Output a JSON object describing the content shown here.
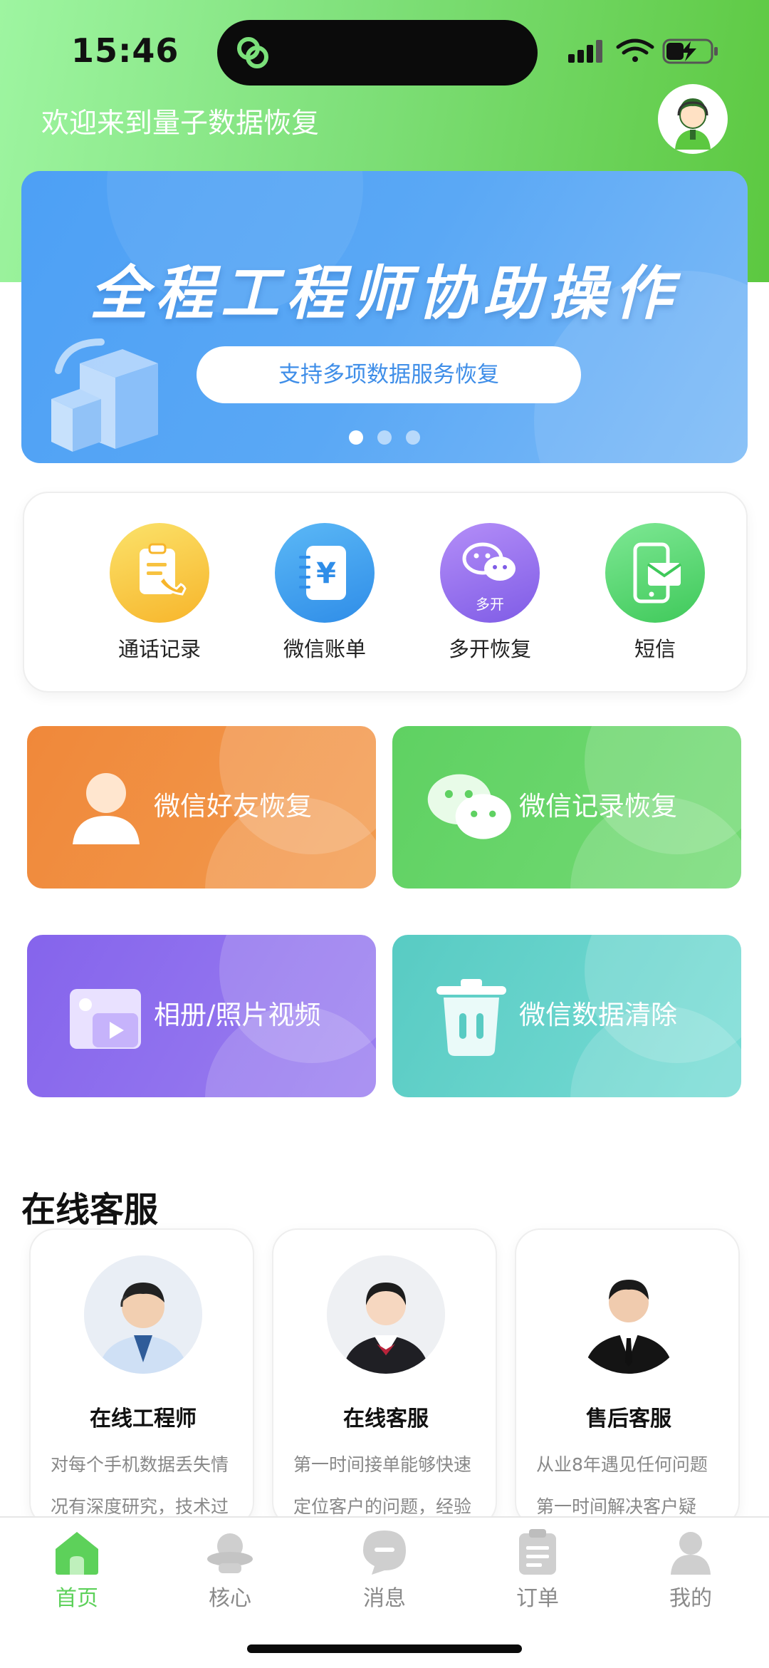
{
  "status_bar": {
    "time": "15:46"
  },
  "header": {
    "welcome": "欢迎来到量子数据恢复"
  },
  "banner": {
    "title": "全程工程师协助操作",
    "pill_text": "支持多项数据服务恢复",
    "page_count": 3,
    "active_page": 1
  },
  "quick_actions": [
    {
      "label": "通话记录",
      "icon": "call-log-icon",
      "badge": ""
    },
    {
      "label": "微信账单",
      "icon": "wechat-bill-icon",
      "badge": ""
    },
    {
      "label": "多开恢复",
      "icon": "multi-open-icon",
      "badge": "多开"
    },
    {
      "label": "短信",
      "icon": "sms-icon",
      "badge": ""
    }
  ],
  "features": [
    {
      "label": "微信好友恢复",
      "icon": "friend-icon",
      "color": "#f08a3a"
    },
    {
      "label": "微信记录恢复",
      "icon": "wechat-icon",
      "color": "#6bd56a"
    },
    {
      "label": "相册/照片视频",
      "icon": "photo-video-icon",
      "color": "#8d6cee"
    },
    {
      "label": "微信数据清除",
      "icon": "trash-icon",
      "color": "#5ecdc6"
    }
  ],
  "support": {
    "title": "在线客服",
    "cards": [
      {
        "name": "在线工程师",
        "desc_line1": "对每个手机数据丢失情",
        "desc_line2": "况有深度研究，技术过"
      },
      {
        "name": "在线客服",
        "desc_line1": "第一时间接单能够快速",
        "desc_line2": "定位客户的问题，经验"
      },
      {
        "name": "售后客服",
        "desc_line1": "从业8年遇见任何问题",
        "desc_line2": "第一时间解决客户疑"
      }
    ]
  },
  "tabbar": {
    "active_color": "#5dd15a",
    "items": [
      {
        "label": "首页",
        "icon": "home-icon"
      },
      {
        "label": "核心",
        "icon": "core-icon"
      },
      {
        "label": "消息",
        "icon": "message-icon"
      },
      {
        "label": "订单",
        "icon": "order-icon"
      },
      {
        "label": "我的",
        "icon": "profile-icon"
      }
    ]
  }
}
